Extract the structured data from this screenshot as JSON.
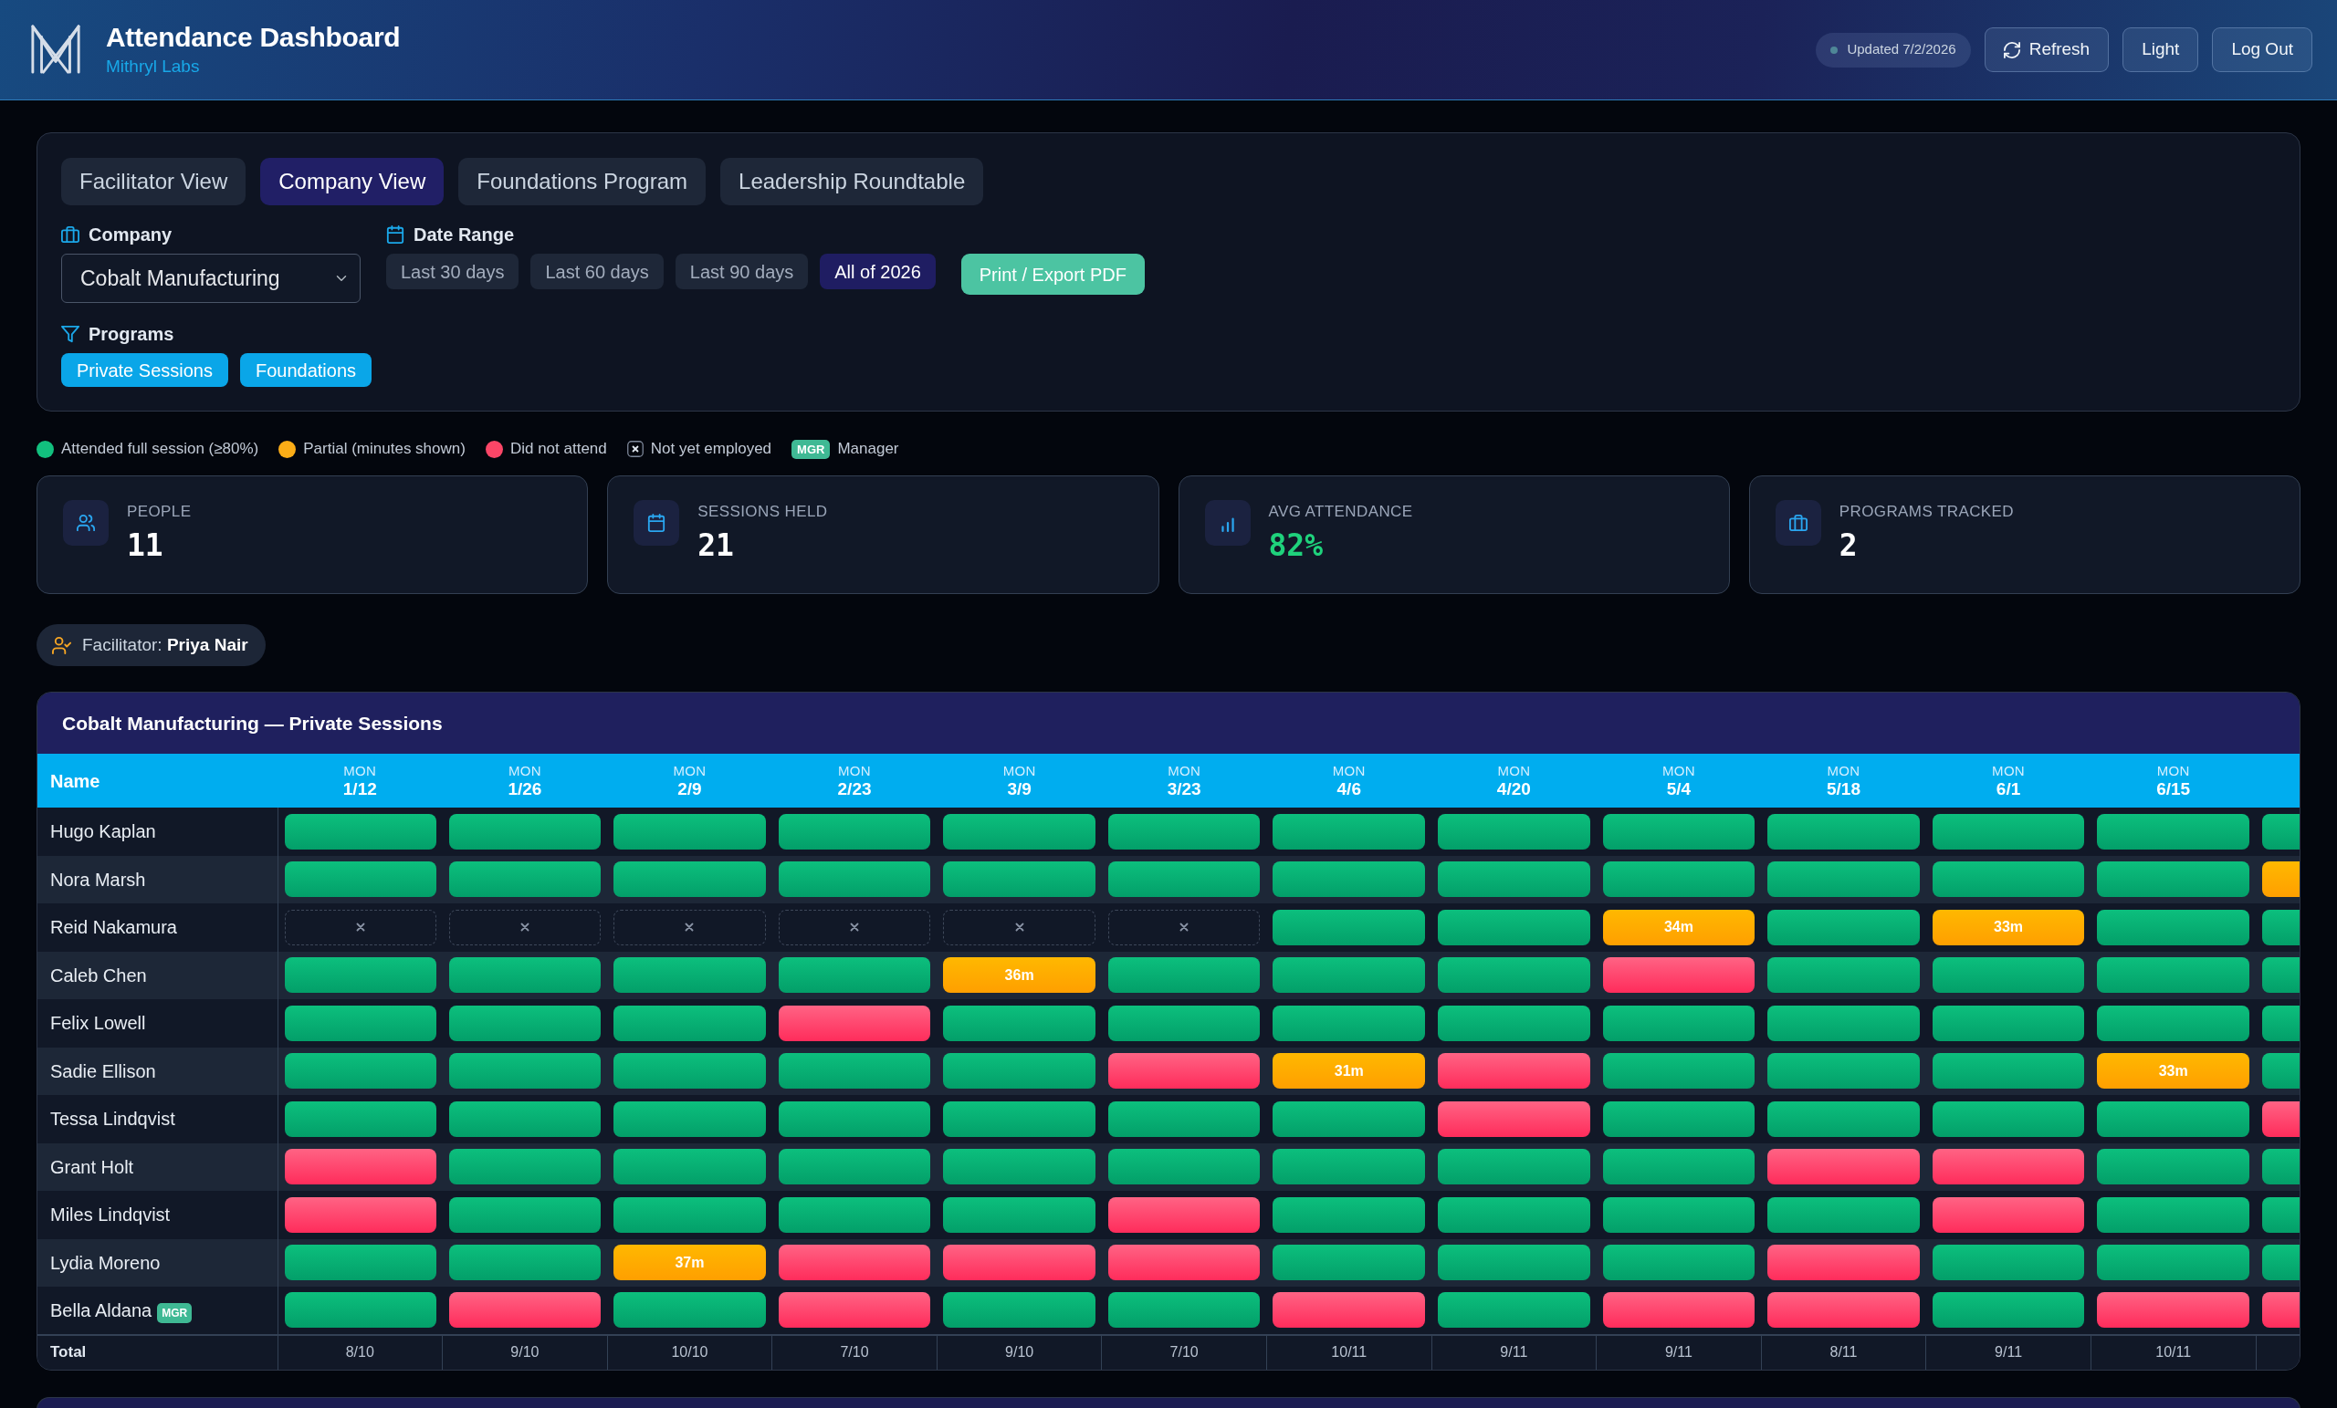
{
  "header": {
    "title": "Attendance Dashboard",
    "subtitle": "Mithryl Labs",
    "updated": "Updated 7/2/2026",
    "buttons": [
      {
        "label": "Refresh",
        "kind": "refresh"
      },
      {
        "label": "Light",
        "kind": "plain"
      },
      {
        "label": "Log Out",
        "kind": "plain"
      }
    ]
  },
  "view_tabs": [
    {
      "label": "Facilitator View",
      "selected": false
    },
    {
      "label": "Company View",
      "selected": true
    },
    {
      "label": "Foundations Program",
      "selected": false
    },
    {
      "label": "Leadership Roundtable",
      "selected": false
    }
  ],
  "filters": {
    "company": {
      "label": "Company",
      "value": "Cobalt Manufacturing"
    },
    "date_range": {
      "label": "Date Range",
      "options": [
        {
          "label": "Last 30 days",
          "selected": false
        },
        {
          "label": "Last 60 days",
          "selected": false
        },
        {
          "label": "Last 90 days",
          "selected": false
        },
        {
          "label": "All of 2026",
          "selected": true
        }
      ]
    },
    "export_button": "Print / Export PDF",
    "programs": {
      "label": "Programs",
      "options": [
        {
          "label": "Private Sessions",
          "selected": true
        },
        {
          "label": "Foundations",
          "selected": true
        }
      ]
    }
  },
  "legend": [
    {
      "kind": "attended",
      "label": "Attended full session (≥80%)"
    },
    {
      "kind": "partial",
      "label": "Partial (minutes shown)"
    },
    {
      "kind": "absent",
      "label": "Did not attend"
    },
    {
      "kind": "unemployed",
      "label": "Not yet employed"
    },
    {
      "kind": "manager",
      "badge": "MGR",
      "label": "Manager"
    }
  ],
  "stats": [
    {
      "kind": "people",
      "label": "PEOPLE",
      "value": "11",
      "highlight": false
    },
    {
      "kind": "sessions",
      "label": "SESSIONS HELD",
      "value": "21",
      "highlight": false
    },
    {
      "kind": "attendance",
      "label": "AVG ATTENDANCE",
      "value": "82%",
      "highlight": true
    },
    {
      "kind": "programs",
      "label": "PROGRAMS TRACKED",
      "value": "2",
      "highlight": false
    }
  ],
  "facilitator": "Facilitator: **Priya Nair**",
  "attendance_table": {
    "title": "Cobalt Manufacturing — Private Sessions",
    "name_header": "Name",
    "columns": [
      {
        "day": "MON",
        "date": "1/12"
      },
      {
        "day": "MON",
        "date": "1/26"
      },
      {
        "day": "MON",
        "date": "2/9"
      },
      {
        "day": "MON",
        "date": "2/23"
      },
      {
        "day": "MON",
        "date": "3/9"
      },
      {
        "day": "MON",
        "date": "3/23"
      },
      {
        "day": "MON",
        "date": "4/6"
      },
      {
        "day": "MON",
        "date": "4/20"
      },
      {
        "day": "MON",
        "date": "5/4"
      },
      {
        "day": "MON",
        "date": "5/18"
      },
      {
        "day": "MON",
        "date": "6/1"
      },
      {
        "day": "MON",
        "date": "6/15"
      }
    ],
    "rows": [
      {
        "name": "Hugo Kaplan",
        "cells": [
          {
            "kind": "attended"
          },
          {
            "kind": "attended"
          },
          {
            "kind": "attended"
          },
          {
            "kind": "attended"
          },
          {
            "kind": "attended"
          },
          {
            "kind": "attended"
          },
          {
            "kind": "attended"
          },
          {
            "kind": "attended"
          },
          {
            "kind": "attended"
          },
          {
            "kind": "attended"
          },
          {
            "kind": "attended"
          },
          {
            "kind": "attended"
          },
          {
            "kind": "attended"
          }
        ]
      },
      {
        "name": "Nora Marsh",
        "cells": [
          {
            "kind": "attended"
          },
          {
            "kind": "attended"
          },
          {
            "kind": "attended"
          },
          {
            "kind": "attended"
          },
          {
            "kind": "attended"
          },
          {
            "kind": "attended"
          },
          {
            "kind": "attended"
          },
          {
            "kind": "attended"
          },
          {
            "kind": "attended"
          },
          {
            "kind": "attended"
          },
          {
            "kind": "attended"
          },
          {
            "kind": "attended"
          },
          {
            "kind": "partial"
          }
        ]
      },
      {
        "name": "Reid Nakamura",
        "cells": [
          {
            "kind": "unemployed"
          },
          {
            "kind": "unemployed"
          },
          {
            "kind": "unemployed"
          },
          {
            "kind": "unemployed"
          },
          {
            "kind": "unemployed"
          },
          {
            "kind": "unemployed"
          },
          {
            "kind": "attended"
          },
          {
            "kind": "attended"
          },
          {
            "kind": "partial",
            "minutes": "34m"
          },
          {
            "kind": "attended"
          },
          {
            "kind": "partial",
            "minutes": "33m"
          },
          {
            "kind": "attended"
          },
          {
            "kind": "attended"
          }
        ]
      },
      {
        "name": "Caleb Chen",
        "cells": [
          {
            "kind": "attended"
          },
          {
            "kind": "attended"
          },
          {
            "kind": "attended"
          },
          {
            "kind": "attended"
          },
          {
            "kind": "partial",
            "minutes": "36m"
          },
          {
            "kind": "attended"
          },
          {
            "kind": "attended"
          },
          {
            "kind": "attended"
          },
          {
            "kind": "absent"
          },
          {
            "kind": "attended"
          },
          {
            "kind": "attended"
          },
          {
            "kind": "attended"
          },
          {
            "kind": "attended"
          }
        ]
      },
      {
        "name": "Felix Lowell",
        "cells": [
          {
            "kind": "attended"
          },
          {
            "kind": "attended"
          },
          {
            "kind": "attended"
          },
          {
            "kind": "absent"
          },
          {
            "kind": "attended"
          },
          {
            "kind": "attended"
          },
          {
            "kind": "attended"
          },
          {
            "kind": "attended"
          },
          {
            "kind": "attended"
          },
          {
            "kind": "attended"
          },
          {
            "kind": "attended"
          },
          {
            "kind": "attended"
          },
          {
            "kind": "attended"
          }
        ]
      },
      {
        "name": "Sadie Ellison",
        "cells": [
          {
            "kind": "attended"
          },
          {
            "kind": "attended"
          },
          {
            "kind": "attended"
          },
          {
            "kind": "attended"
          },
          {
            "kind": "attended"
          },
          {
            "kind": "absent"
          },
          {
            "kind": "partial",
            "minutes": "31m"
          },
          {
            "kind": "absent"
          },
          {
            "kind": "attended"
          },
          {
            "kind": "attended"
          },
          {
            "kind": "attended"
          },
          {
            "kind": "partial",
            "minutes": "33m"
          },
          {
            "kind": "attended"
          }
        ]
      },
      {
        "name": "Tessa Lindqvist",
        "cells": [
          {
            "kind": "attended"
          },
          {
            "kind": "attended"
          },
          {
            "kind": "attended"
          },
          {
            "kind": "attended"
          },
          {
            "kind": "attended"
          },
          {
            "kind": "attended"
          },
          {
            "kind": "attended"
          },
          {
            "kind": "absent"
          },
          {
            "kind": "attended"
          },
          {
            "kind": "attended"
          },
          {
            "kind": "attended"
          },
          {
            "kind": "attended"
          },
          {
            "kind": "absent"
          }
        ]
      },
      {
        "name": "Grant Holt",
        "cells": [
          {
            "kind": "absent"
          },
          {
            "kind": "attended"
          },
          {
            "kind": "attended"
          },
          {
            "kind": "attended"
          },
          {
            "kind": "attended"
          },
          {
            "kind": "attended"
          },
          {
            "kind": "attended"
          },
          {
            "kind": "attended"
          },
          {
            "kind": "attended"
          },
          {
            "kind": "absent"
          },
          {
            "kind": "absent"
          },
          {
            "kind": "attended"
          },
          {
            "kind": "attended"
          }
        ]
      },
      {
        "name": "Miles Lindqvist",
        "cells": [
          {
            "kind": "absent"
          },
          {
            "kind": "attended"
          },
          {
            "kind": "attended"
          },
          {
            "kind": "attended"
          },
          {
            "kind": "attended"
          },
          {
            "kind": "absent"
          },
          {
            "kind": "attended"
          },
          {
            "kind": "attended"
          },
          {
            "kind": "attended"
          },
          {
            "kind": "attended"
          },
          {
            "kind": "absent"
          },
          {
            "kind": "attended"
          },
          {
            "kind": "attended"
          }
        ]
      },
      {
        "name": "Lydia Moreno",
        "cells": [
          {
            "kind": "attended"
          },
          {
            "kind": "attended"
          },
          {
            "kind": "partial",
            "minutes": "37m"
          },
          {
            "kind": "absent"
          },
          {
            "kind": "absent"
          },
          {
            "kind": "absent"
          },
          {
            "kind": "attended"
          },
          {
            "kind": "attended"
          },
          {
            "kind": "attended"
          },
          {
            "kind": "absent"
          },
          {
            "kind": "attended"
          },
          {
            "kind": "attended"
          },
          {
            "kind": "attended"
          }
        ]
      },
      {
        "name": "Bella Aldana",
        "badge": "MGR",
        "cells": [
          {
            "kind": "attended"
          },
          {
            "kind": "absent"
          },
          {
            "kind": "attended"
          },
          {
            "kind": "absent"
          },
          {
            "kind": "attended"
          },
          {
            "kind": "attended"
          },
          {
            "kind": "absent"
          },
          {
            "kind": "attended"
          },
          {
            "kind": "absent"
          },
          {
            "kind": "absent"
          },
          {
            "kind": "attended"
          },
          {
            "kind": "absent"
          },
          {
            "kind": "absent"
          }
        ]
      }
    ],
    "total_label": "Total",
    "totals": [
      "8/10",
      "9/10",
      "10/10",
      "7/10",
      "9/10",
      "7/10",
      "10/11",
      "9/11",
      "9/11",
      "8/11",
      "9/11",
      "10/11"
    ]
  }
}
